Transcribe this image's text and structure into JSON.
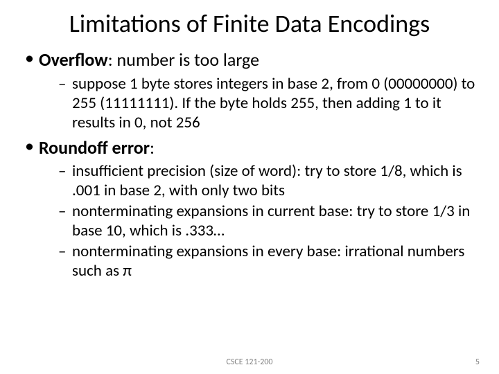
{
  "title": "Limitations of Finite Data Encodings",
  "bullets": [
    {
      "label": "Overflow",
      "after": ":  number is too large",
      "subs": [
        "suppose 1 byte stores integers in base 2, from 0 (00000000) to 255 (11111111).  If the byte holds 255, then adding 1 to it results in 0, not 256"
      ]
    },
    {
      "label": "Roundoff error",
      "after": ":",
      "subs": [
        "insufficient precision (size of word):  try to store 1/8, which is .001 in base 2, with only two bits",
        "nonterminating expansions in current base:  try to store 1/3 in base 10, which is .333…",
        "nonterminating expansions in every base:  irrational numbers such as π"
      ]
    }
  ],
  "footer": {
    "course": "CSCE 121-200",
    "page": "5"
  }
}
